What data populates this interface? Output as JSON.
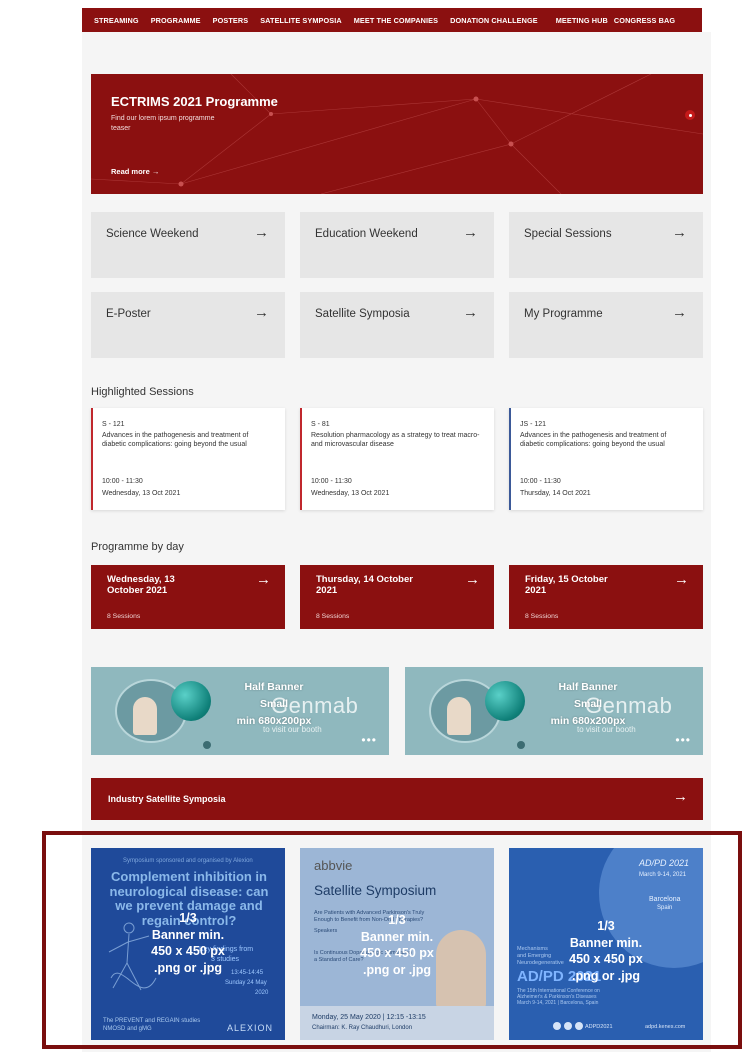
{
  "nav": {
    "items": [
      "STREAMING",
      "PROGRAMME",
      "POSTERS",
      "SATELLITE SYMPOSIA",
      "MEET THE COMPANIES",
      "DONATION CHALLENGE",
      "MEETING HUB",
      "CONGRESS BAG"
    ]
  },
  "hero": {
    "title": "ECTRIMS 2021 Programme",
    "subtitle": "Find our lorem ipsum programme teaser",
    "read_more": "Read more →"
  },
  "tiles": [
    {
      "label": "Science Weekend"
    },
    {
      "label": "Education Weekend"
    },
    {
      "label": "Special Sessions"
    },
    {
      "label": "E-Poster"
    },
    {
      "label": "Satellite Symposia"
    },
    {
      "label": "My Programme"
    }
  ],
  "highlighted": {
    "title": "Highlighted Sessions",
    "cards": [
      {
        "code": "S - 121",
        "title": "Advances in the pathogenesis and treatment of diabetic complications: going beyond the usual",
        "time": "10:00 - 11:30",
        "date": "Wednesday, 13 Oct 2021",
        "accent": "#c0272d"
      },
      {
        "code": "S - 81",
        "title": "Resolution pharmacology as a strategy to treat macro- and microvascular disease",
        "time": "10:00 - 11:30",
        "date": "Wednesday, 13 Oct 2021",
        "accent": "#c0272d"
      },
      {
        "code": "JS - 121",
        "title": "Advances in the pathogenesis and treatment of diabetic complications: going beyond the usual",
        "time": "10:00 - 11:30",
        "date": "Thursday, 14 Oct 2021",
        "accent": "#3b5998"
      }
    ]
  },
  "by_day": {
    "title": "Programme by day",
    "days": [
      {
        "date": "Wednesday, 13 October 2021",
        "sessions": "8 Sessions"
      },
      {
        "date": "Thursday, 14 October 2021",
        "sessions": "8 Sessions"
      },
      {
        "date": "Friday, 15 October 2021",
        "sessions": "8 Sessions"
      }
    ]
  },
  "banners": [
    {
      "line1": "Half Banner",
      "line2": "Small",
      "line3": "min 680x200px",
      "brand": "Genmab",
      "visit": "to visit our booth"
    },
    {
      "line1": "Half Banner",
      "line2": "Small",
      "line3": "min 680x200px",
      "brand": "Genmab",
      "visit": "to visit our booth"
    }
  ],
  "industry": {
    "label": "Industry Satellite Symposia"
  },
  "promos": [
    {
      "bg_top": "Symposium sponsored and organised by Alexion",
      "headline": "Complement inhibition in neurological disease: can we prevent damage and regain control?",
      "overlay": [
        "1/3",
        "Banner min.",
        "450 x 450 px",
        ".png or .jpg"
      ],
      "sub1": "Key findings from",
      "sub2": "3 studies",
      "sub3": "13:45-14:45",
      "sub4": "Sunday 24 May",
      "sub5": "2020",
      "footer": "The PREVENT and REGAIN studies",
      "footer2": "NMOSD and gMG",
      "brand": "ALEXION"
    },
    {
      "logo": "abbvie",
      "headline": "Satellite Symposium",
      "overlay": [
        "1/3",
        "Banner min.",
        "450 x 450 px",
        ".png or .jpg"
      ],
      "q1": "Are Patients with Advanced Parkinson's Truly",
      "q2": "Enough to Benefit from Non-Oral Therapies?",
      "speakers": "Speakers",
      "cont": "Is Continuous Dopaminergic Stimulation",
      "cont2": "a Standard of Care?",
      "date": "Monday, 25 May 2020 | 12:15 -13:15",
      "chair": "Chairman: K. Ray Chaudhuri, London"
    },
    {
      "tag1": "AD/PD 2021",
      "tag2": "March 9-14, 2021",
      "city": "Barcelona",
      "city2": "Spain",
      "left1": "Mechanisms",
      "left2": "and Emerging",
      "left3": "Neurodegenerative",
      "overlay": [
        "1/3",
        "Banner min.",
        "450 x 450 px",
        ".png or .jpg"
      ],
      "big": "AD/PD 2021",
      "conf1": "The 15th International Conference on",
      "conf2": "Alzheimer's & Parkinson's Diseases",
      "conf3": "March 9-14, 2021 | Barcelona, Spain",
      "social": "ADPD2021",
      "site": "adpd.kenes.com"
    }
  ]
}
